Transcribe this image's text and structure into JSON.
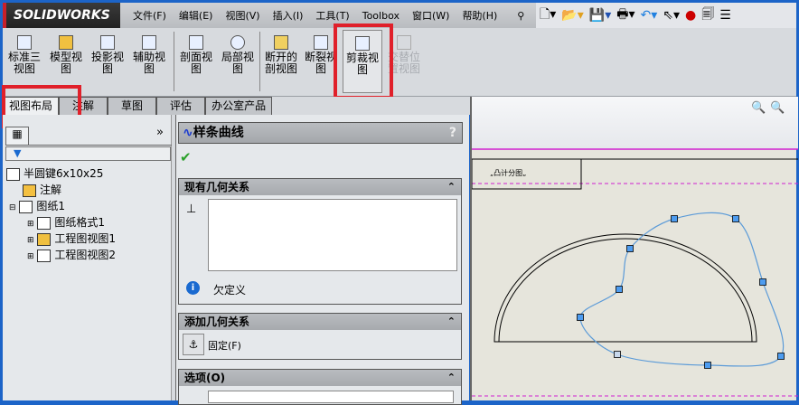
{
  "app": {
    "logo": "SOLIDWORKS"
  },
  "menu": [
    "文件(F)",
    "编辑(E)",
    "视图(V)",
    "插入(I)",
    "工具(T)",
    "Toolbox",
    "窗口(W)",
    "帮助(H)"
  ],
  "quick_access": [
    "pin-icon",
    "new-file-icon",
    "open-file-icon",
    "save-icon",
    "print-icon",
    "undo-icon",
    "select-icon",
    "rebuild-icon",
    "file-properties-icon",
    "options-icon"
  ],
  "ribbon": [
    {
      "l1": "标准三",
      "l2": "视图"
    },
    {
      "l1": "模型视",
      "l2": "图"
    },
    {
      "l1": "投影视",
      "l2": "图"
    },
    {
      "l1": "辅助视",
      "l2": "图"
    },
    {
      "l1": "剖面视",
      "l2": "图"
    },
    {
      "l1": "局部视",
      "l2": "图"
    },
    {
      "l1": "断开的",
      "l2": "剖视图"
    },
    {
      "l1": "断裂视",
      "l2": "图"
    },
    {
      "l1": "剪裁视",
      "l2": "图"
    },
    {
      "l1": "交替位",
      "l2": "置视图"
    }
  ],
  "tabs": [
    "视图布局",
    "注解",
    "草图",
    "评估",
    "办公室产品"
  ],
  "tree": {
    "root": "半圆键6x10x25",
    "items": [
      "注解",
      "图纸1",
      "图纸格式1",
      "工程图视图1",
      "工程图视图2"
    ]
  },
  "pm": {
    "title": "样条曲线",
    "help": "?",
    "existing": "现有几何关系",
    "status": "欠定义",
    "add": "添加几何关系",
    "fix": "固定(F)",
    "options": "选项(O)"
  },
  "drawing": {
    "title_block_text": "„凸计分图„"
  },
  "colors": {
    "highlight": "#e0202a",
    "spline": "#5a9ad8",
    "spline_point": "#4d9cf0",
    "sheet_border": "#d020d0"
  }
}
